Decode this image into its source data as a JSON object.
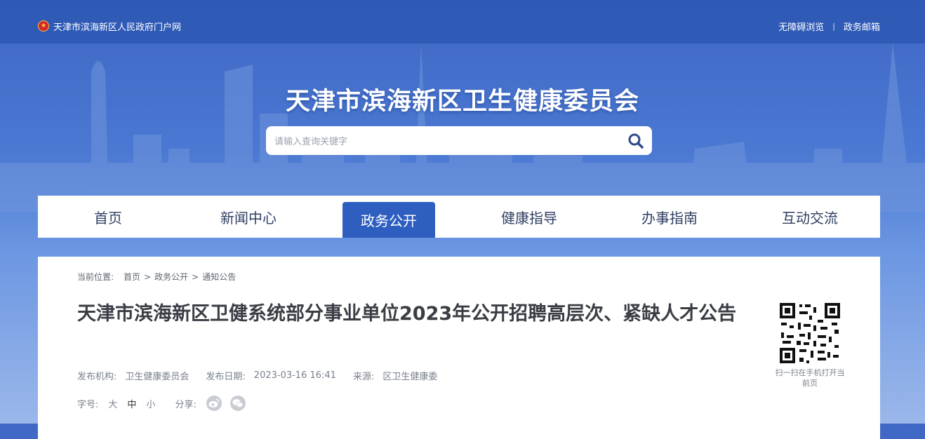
{
  "topbar": {
    "portal_name": "天津市滨海新区人民政府门户网",
    "accessible_browse": "无障碍浏览",
    "separator": "|",
    "gov_mail": "政务邮箱"
  },
  "header": {
    "site_title": "天津市滨海新区卫生健康委员会",
    "search_placeholder": "请输入查询关键字"
  },
  "nav": {
    "items": [
      {
        "label": "首页"
      },
      {
        "label": "新闻中心"
      },
      {
        "label": "政务公开",
        "active": true
      },
      {
        "label": "健康指导"
      },
      {
        "label": "办事指南"
      },
      {
        "label": "互动交流"
      }
    ]
  },
  "breadcrumb": {
    "label": "当前位置:",
    "items": [
      "首页",
      "政务公开",
      "通知公告"
    ],
    "arrow": ">"
  },
  "article": {
    "title": "天津市滨海新区卫健系统部分事业单位2023年公开招聘高层次、紧缺人才公告",
    "publisher_label": "发布机构:",
    "publisher": "卫生健康委员会",
    "date_label": "发布日期:",
    "date": "2023-03-16 16:41",
    "source_label": "来源:",
    "source": "区卫生健康委",
    "font_label": "字号:",
    "font_large": "大",
    "font_medium": "中",
    "font_small": "小",
    "share_label": "分享:",
    "qr_caption": "扫一扫在手机打开当前页"
  },
  "colors": {
    "brand_blue": "#2e5fc0",
    "nav_text": "#2f3f62"
  }
}
